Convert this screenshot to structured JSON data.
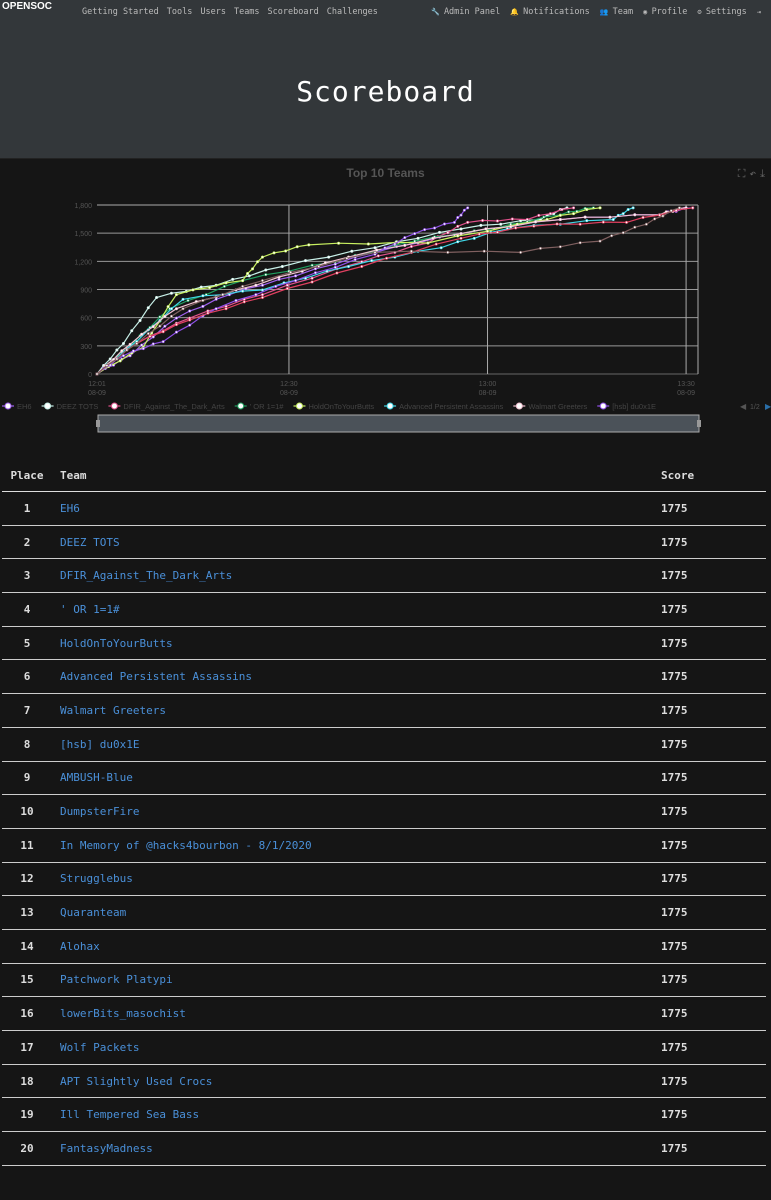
{
  "nav": {
    "logo": "OPENSOC",
    "left": [
      "Getting Started",
      "Tools",
      "Users",
      "Teams",
      "Scoreboard",
      "Challenges"
    ],
    "right": [
      {
        "icon": "wrench-icon",
        "label": "Admin Panel"
      },
      {
        "icon": "bell-icon",
        "label": "Notifications"
      },
      {
        "icon": "users-icon",
        "label": "Team"
      },
      {
        "icon": "user-circle-icon",
        "label": "Profile"
      },
      {
        "icon": "cogs-icon",
        "label": "Settings"
      },
      {
        "icon": "logout-icon",
        "label": ""
      }
    ]
  },
  "page_title": "Scoreboard",
  "chart_data": {
    "type": "line",
    "title": "Top 10 Teams",
    "ylim": [
      0,
      1800
    ],
    "yticks": [
      "0",
      "300",
      "600",
      "900",
      "1,200",
      "1,500",
      "1,800"
    ],
    "xticks": [
      [
        "12:01",
        "08-09"
      ],
      [
        "12:30",
        "08-09"
      ],
      [
        "13:00",
        "08-09"
      ],
      [
        "13:30",
        "08-09"
      ]
    ],
    "legend_page": "1/2",
    "series": [
      {
        "name": "EH6",
        "color": "#a060f0",
        "points": [
          [
            0,
            0
          ],
          [
            5,
            200
          ],
          [
            12,
            600
          ],
          [
            20,
            850
          ],
          [
            30,
            1050
          ],
          [
            42,
            1300
          ],
          [
            55,
            1500
          ],
          [
            70,
            1650
          ],
          [
            85,
            1700
          ],
          [
            90,
            1775
          ]
        ]
      },
      {
        "name": "DEEZ TOTS",
        "color": "#c8f0e8",
        "points": [
          [
            0,
            0
          ],
          [
            4,
            330
          ],
          [
            9,
            820
          ],
          [
            18,
            950
          ],
          [
            28,
            1150
          ],
          [
            42,
            1350
          ],
          [
            55,
            1550
          ],
          [
            67,
            1650
          ],
          [
            71,
            1775
          ]
        ]
      },
      {
        "name": "DFIR_Against_The_Dark_Arts",
        "color": "#e0508a",
        "points": [
          [
            0,
            0
          ],
          [
            6,
            330
          ],
          [
            14,
            600
          ],
          [
            25,
            850
          ],
          [
            40,
            1200
          ],
          [
            50,
            1400
          ],
          [
            56,
            1620
          ],
          [
            65,
            1650
          ],
          [
            72,
            1775
          ]
        ]
      },
      {
        "name": "' OR 1=1#",
        "color": "#20a060",
        "points": [
          [
            0,
            0
          ],
          [
            5,
            300
          ],
          [
            11,
            700
          ],
          [
            22,
            1000
          ],
          [
            36,
            1200
          ],
          [
            48,
            1420
          ],
          [
            60,
            1550
          ],
          [
            70,
            1700
          ],
          [
            75,
            1775
          ]
        ]
      },
      {
        "name": "HoldOnToYourButts",
        "color": "#c8f060",
        "points": [
          [
            0,
            0
          ],
          [
            7,
            290
          ],
          [
            12,
            850
          ],
          [
            22,
            1000
          ],
          [
            25,
            1250
          ],
          [
            32,
            1380
          ],
          [
            50,
            1400
          ],
          [
            68,
            1650
          ],
          [
            76,
            1775
          ]
        ]
      },
      {
        "name": "Advanced Persistent Assassins",
        "color": "#40d8e8",
        "points": [
          [
            0,
            0
          ],
          [
            6,
            350
          ],
          [
            13,
            800
          ],
          [
            25,
            900
          ],
          [
            38,
            1150
          ],
          [
            52,
            1350
          ],
          [
            62,
            1550
          ],
          [
            78,
            1650
          ],
          [
            81,
            1775
          ]
        ]
      },
      {
        "name": "Walmart Greeters",
        "color": "#f0c0d0",
        "points": [
          [
            0,
            0
          ],
          [
            5,
            320
          ],
          [
            12,
            700
          ],
          [
            24,
            950
          ],
          [
            38,
            1250
          ],
          [
            55,
            1500
          ],
          [
            70,
            1650
          ],
          [
            85,
            1700
          ],
          [
            89,
            1775
          ]
        ]
      },
      {
        "name": "[hsb] du0x1E",
        "color": "#9050e8",
        "points": [
          [
            0,
            0
          ],
          [
            4,
            200
          ],
          [
            10,
            350
          ],
          [
            18,
            700
          ],
          [
            30,
            1000
          ],
          [
            42,
            1280
          ],
          [
            48,
            1500
          ],
          [
            54,
            1620
          ],
          [
            56,
            1775
          ]
        ]
      },
      {
        "name": "AMBUSH-Blue",
        "color": "#e04060",
        "points": [
          [
            0,
            0
          ],
          [
            6,
            330
          ],
          [
            14,
            580
          ],
          [
            25,
            820
          ],
          [
            40,
            1150
          ],
          [
            55,
            1450
          ],
          [
            66,
            1580
          ],
          [
            80,
            1620
          ],
          [
            90,
            1775
          ]
        ]
      },
      {
        "name": "DumpsterFire",
        "color": "#806060",
        "points": [
          [
            0,
            0
          ],
          [
            6,
            330
          ],
          [
            13,
            700
          ],
          [
            25,
            1000
          ],
          [
            42,
            1300
          ],
          [
            64,
            1300
          ],
          [
            76,
            1420
          ],
          [
            83,
            1600
          ],
          [
            88,
            1775
          ]
        ]
      }
    ]
  },
  "table": {
    "headers": [
      "Place",
      "Team",
      "Score"
    ],
    "rows": [
      [
        "1",
        "EH6",
        "1775"
      ],
      [
        "2",
        "DEEZ TOTS",
        "1775"
      ],
      [
        "3",
        "DFIR_Against_The_Dark_Arts",
        "1775"
      ],
      [
        "4",
        "' OR 1=1#",
        "1775"
      ],
      [
        "5",
        "HoldOnToYourButts",
        "1775"
      ],
      [
        "6",
        "Advanced Persistent Assassins",
        "1775"
      ],
      [
        "7",
        "Walmart Greeters",
        "1775"
      ],
      [
        "8",
        "[hsb] du0x1E",
        "1775"
      ],
      [
        "9",
        "AMBUSH-Blue",
        "1775"
      ],
      [
        "10",
        "DumpsterFire",
        "1775"
      ],
      [
        "11",
        "In Memory of @hacks4bourbon - 8/1/2020",
        "1775"
      ],
      [
        "12",
        "Strugglebus",
        "1775"
      ],
      [
        "13",
        "Quaranteam",
        "1775"
      ],
      [
        "14",
        "Alohax",
        "1775"
      ],
      [
        "15",
        "Patchwork Platypi",
        "1775"
      ],
      [
        "16",
        "lowerBits_masochist",
        "1775"
      ],
      [
        "17",
        "Wolf Packets",
        "1775"
      ],
      [
        "18",
        "APT Slightly Used Crocs",
        "1775"
      ],
      [
        "19",
        "Ill Tempered Sea Bass",
        "1775"
      ],
      [
        "20",
        "FantasyMadness",
        "1775"
      ]
    ]
  }
}
